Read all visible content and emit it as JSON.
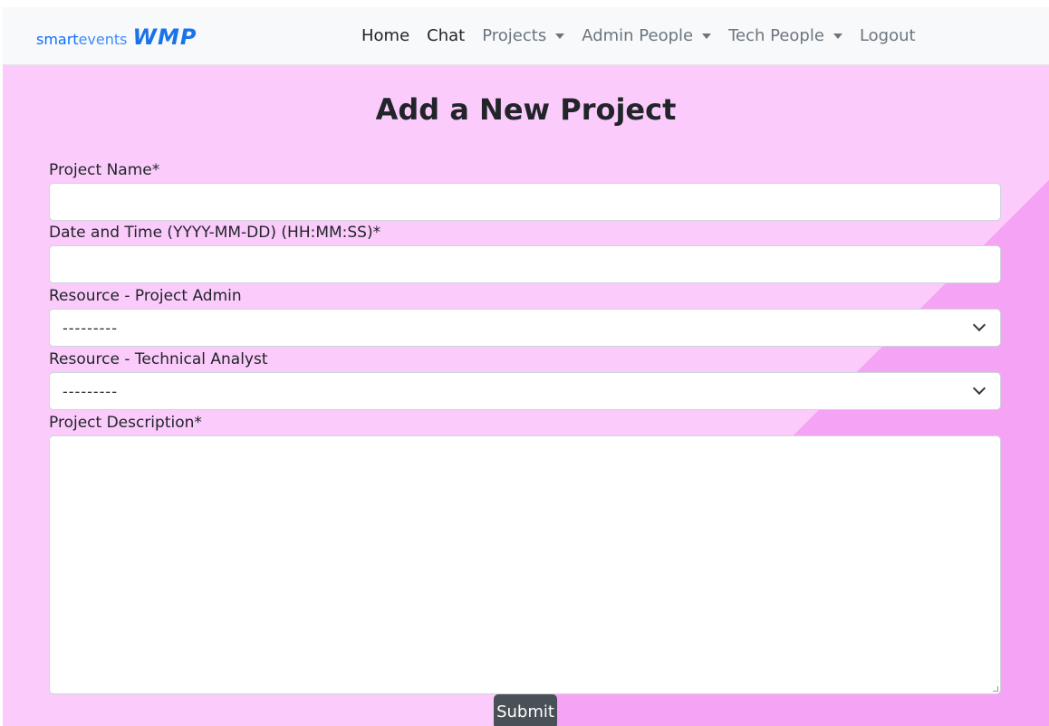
{
  "brand": {
    "smart": "smart",
    "events": "events",
    "wmp": "WMP"
  },
  "nav": {
    "home": "Home",
    "chat": "Chat",
    "projects": "Projects",
    "admin_people": "Admin People",
    "tech_people": "Tech People",
    "logout": "Logout"
  },
  "page": {
    "title": "Add a New Project"
  },
  "form": {
    "project_name": {
      "label": "Project Name*",
      "value": ""
    },
    "date_time": {
      "label": "Date and Time (YYYY-MM-DD) (HH:MM:SS)*",
      "value": ""
    },
    "project_admin": {
      "label": "Resource - Project Admin",
      "selected": "---------"
    },
    "technical_analyst": {
      "label": "Resource - Technical Analyst",
      "selected": "---------"
    },
    "description": {
      "label": "Project Description*",
      "value": ""
    },
    "submit_label": "Submit"
  },
  "colors": {
    "background_light": "#fbccfb",
    "background_dark": "#f5a3f5",
    "navbar": "#f8f9fa",
    "brand_blue": "#0d6efd",
    "submit_button": "#495057"
  },
  "icons": {
    "dropdown_caret": "caret-down-icon",
    "select_chevron": "chevron-down-icon",
    "textarea_resize": "resize-grip-icon"
  }
}
